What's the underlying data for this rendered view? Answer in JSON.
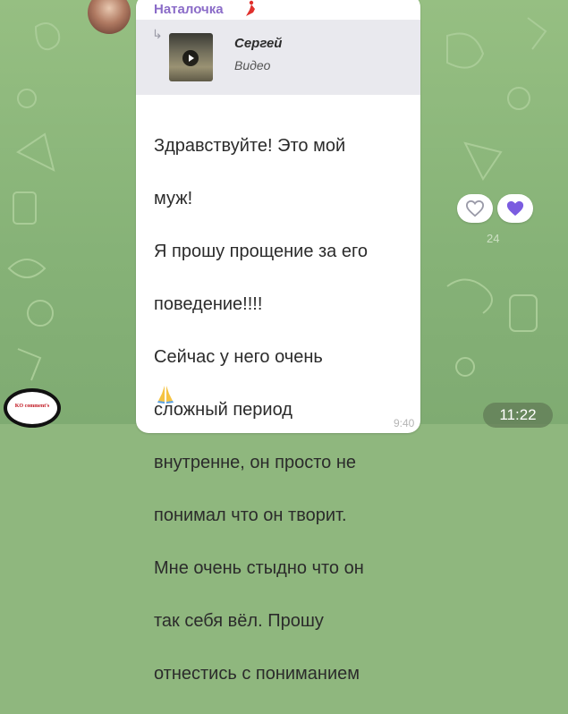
{
  "message": {
    "sender": "Наталочка",
    "reply": {
      "author": "Сергей",
      "type": "Видео"
    },
    "lines": [
      "Здравствуйте! Это мой",
      "муж!",
      "Я прошу прощение за его",
      "поведение!!!!",
      "Сейчас у него очень",
      "сложный период",
      "внутренне, он просто не",
      "понимал что он творит.",
      "Мне очень стыдно что он",
      "так себя вёл. Прошу",
      "отнестись с пониманием"
    ],
    "emoji": "pray-icon",
    "time": "9:40"
  },
  "reactions": {
    "count": "24",
    "outline_icon": "heart-outline-icon",
    "filled_icon": "heart-filled-icon",
    "filled_color": "#7b5ce0"
  },
  "status": {
    "time": "11:22"
  },
  "watermark": {
    "text": "KO comment's"
  }
}
